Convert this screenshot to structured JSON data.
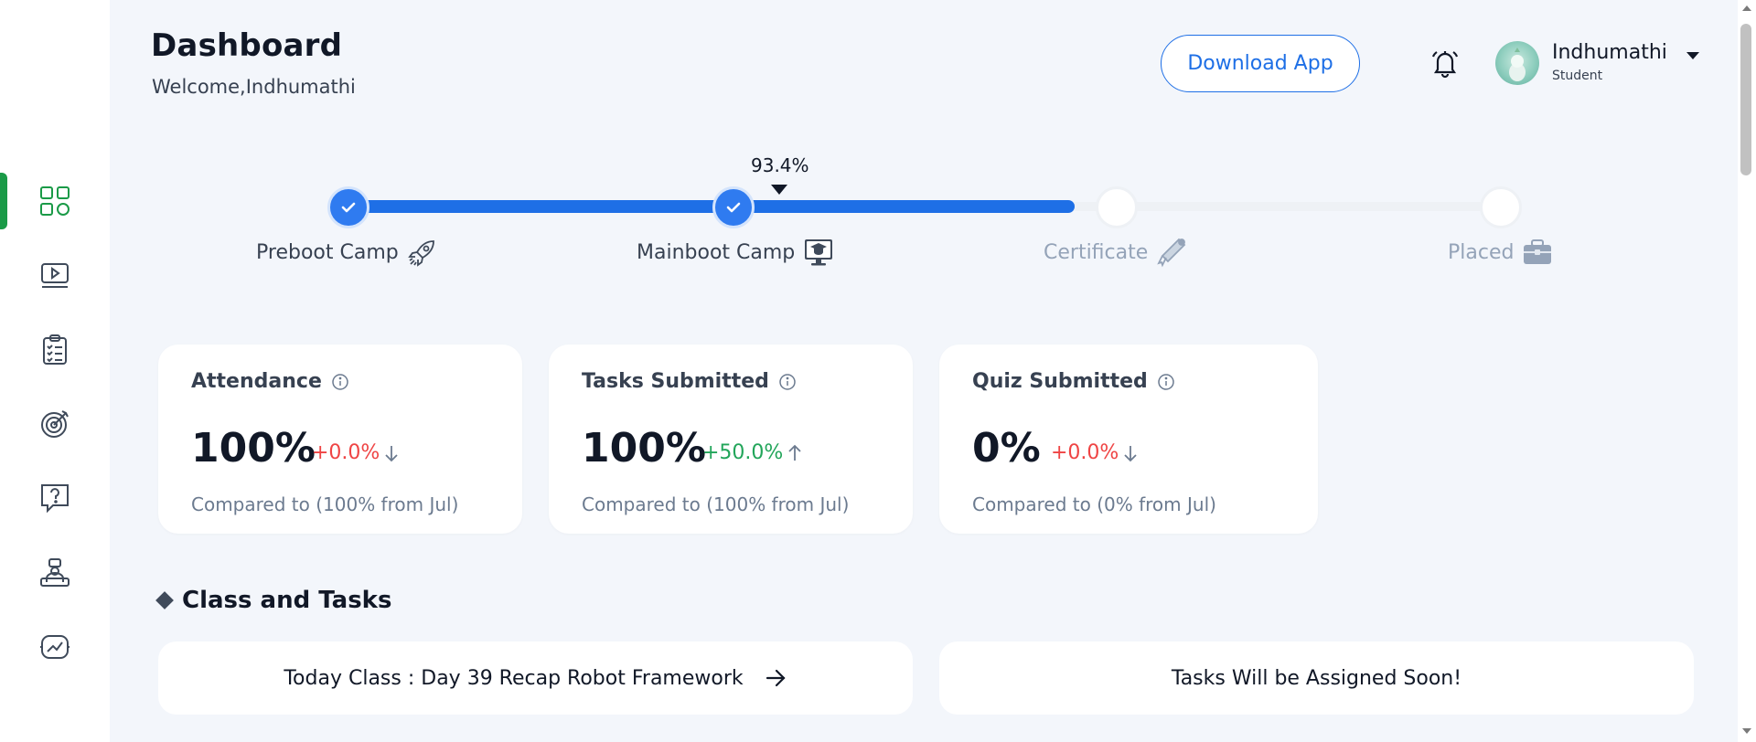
{
  "header": {
    "title": "Dashboard",
    "welcome": "Welcome,Indhumathi",
    "download_label": "Download App"
  },
  "user": {
    "name": "Indhumathi",
    "role": "Student"
  },
  "sidebar": {
    "items": [
      {
        "name": "dashboard",
        "icon": "grid-icon",
        "active": true
      },
      {
        "name": "classes",
        "icon": "video-screen-icon",
        "active": false
      },
      {
        "name": "tasks",
        "icon": "clipboard-checklist-icon",
        "active": false
      },
      {
        "name": "goals",
        "icon": "target-icon",
        "active": false
      },
      {
        "name": "queries",
        "icon": "question-chat-icon",
        "active": false
      },
      {
        "name": "mentor",
        "icon": "person-desk-icon",
        "active": false
      },
      {
        "name": "reports",
        "icon": "chart-screen-icon",
        "active": false
      }
    ],
    "accent_color": "#1a9a47"
  },
  "progress": {
    "percent_label": "93.4%",
    "percent_value": 93.4,
    "steps": [
      {
        "label": "Preboot Camp",
        "icon": "rocket-icon",
        "done": true
      },
      {
        "label": "Mainboot Camp",
        "icon": "graduate-monitor-icon",
        "done": true
      },
      {
        "label": "Certificate",
        "icon": "certificate-scroll-icon",
        "done": false
      },
      {
        "label": "Placed",
        "icon": "briefcase-icon",
        "done": false
      }
    ],
    "fill_color": "#1e6fe6"
  },
  "stats": [
    {
      "title": "Attendance",
      "value": "100%",
      "delta": "+0.0%",
      "direction": "down",
      "compare": "Compared to (100% from Jul)"
    },
    {
      "title": "Tasks Submitted",
      "value": "100%",
      "delta": "+50.0%",
      "direction": "up",
      "compare": "Compared to (100% from Jul)"
    },
    {
      "title": "Quiz Submitted",
      "value": "0%",
      "delta": "+0.0%",
      "direction": "down",
      "compare": "Compared to (0% from Jul)"
    }
  ],
  "section": {
    "title": "Class and Tasks",
    "today_class": "Today Class : Day 39 Recap Robot Framework",
    "tasks_message": "Tasks Will be Assigned Soon!"
  },
  "colors": {
    "primary": "#1e6fe6",
    "negative": "#ef4444",
    "positive": "#22a55a"
  }
}
